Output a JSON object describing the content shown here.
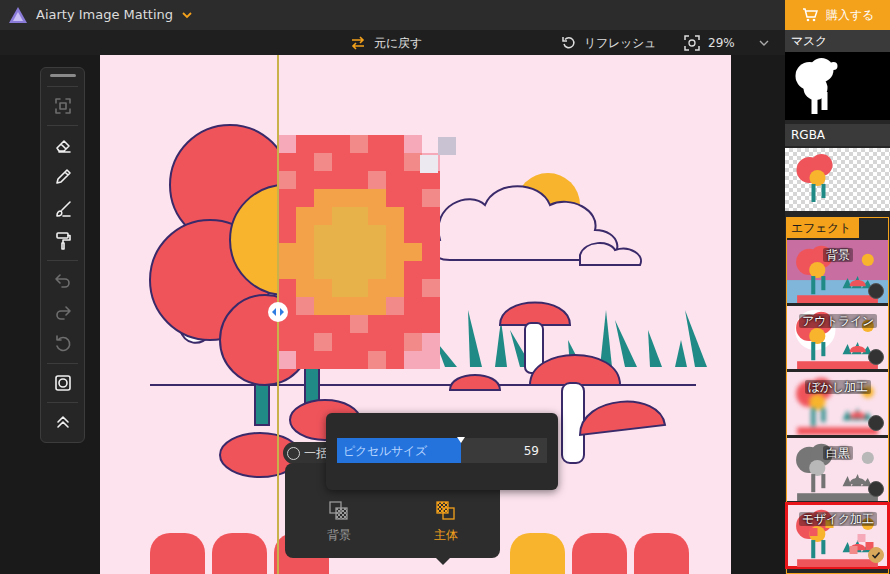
{
  "window": {
    "title": "Aiarty Image Matting"
  },
  "purchase": {
    "label": "購入する"
  },
  "toolbar": {
    "undo": "元に戻す",
    "refresh": "リフレッシュ",
    "zoom": "29%"
  },
  "tools": [
    {
      "disabled": true
    },
    {
      "disabled": false
    },
    {
      "disabled": false
    },
    {
      "disabled": false
    },
    {
      "disabled": false
    },
    {
      "disabled": true
    },
    {
      "disabled": true
    },
    {
      "disabled": true
    },
    {
      "disabled": false
    },
    {
      "disabled": false
    }
  ],
  "compare": {
    "level": 0.28
  },
  "pixel_size": {
    "label": "ピクセルサイズ",
    "value": "59",
    "level": 0.59
  },
  "batch": {
    "label": "一括",
    "checked": false
  },
  "targets": [
    {
      "label": "背景",
      "selected": false
    },
    {
      "label": "主体",
      "selected": true
    }
  ],
  "panels": {
    "mask": "マスク",
    "rgba": "RGBA",
    "effects": "エフェクト"
  },
  "effects": [
    {
      "label": "背景",
      "kind": "background",
      "selected": false,
      "highlighted": false
    },
    {
      "label": "アウトライン",
      "kind": "outline",
      "selected": false,
      "highlighted": false
    },
    {
      "label": "ぼかし加工",
      "kind": "blur",
      "selected": false,
      "highlighted": false
    },
    {
      "label": "白黒",
      "kind": "bw",
      "selected": false,
      "highlighted": false
    },
    {
      "label": "モザイク加工",
      "kind": "mosaic",
      "selected": true,
      "highlighted": true
    }
  ]
}
